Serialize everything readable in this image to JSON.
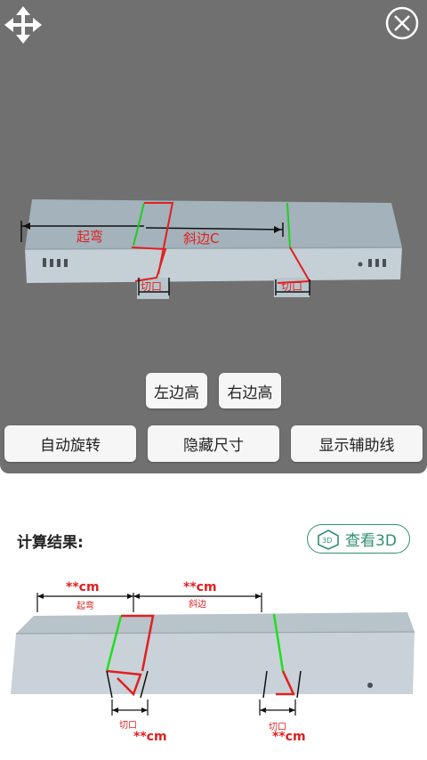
{
  "viewer": {
    "labels": {
      "bend": "起弯",
      "bevel": "斜边C",
      "cut_left": "切口",
      "cut_right": "切口"
    },
    "buttons": {
      "left_height": "左边高",
      "right_height": "右边高",
      "auto_rotate": "自动旋转",
      "hide_size": "隐藏尺寸",
      "show_guides": "显示辅助线"
    }
  },
  "result": {
    "title": "计算结果:",
    "view3d_label": "查看3D",
    "diagram": {
      "bend_value": "**cm",
      "bend_label": "起弯",
      "bevel_value": "**cm",
      "bevel_label": "斜边",
      "cut_left_label": "切口",
      "cut_left_value": "**cm",
      "cut_right_label": "切口",
      "cut_right_value": "**cm"
    }
  },
  "colors": {
    "accent": "#2f8f74",
    "viewer_bg": "#707070",
    "mark_red": "#e02020",
    "mark_green": "#22cc22"
  }
}
